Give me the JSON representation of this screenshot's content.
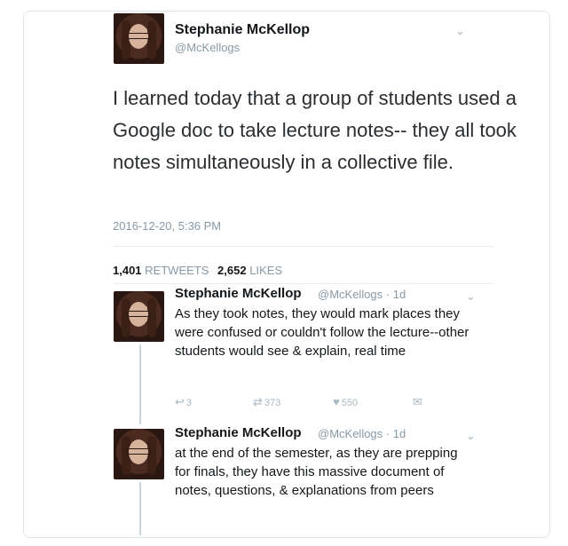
{
  "tweet": {
    "author_name": "Stephanie McKellop",
    "author_handle": "@McKellogs",
    "text": "I learned today that a group of students used a Google doc to take lecture notes-- they all took notes simultaneously in a collective file.",
    "timestamp": "2016-12-20, 5:36 PM",
    "retweets_count": "1,401",
    "retweets_label": "RETWEETS",
    "likes_count": "2,652",
    "likes_label": "LIKES"
  },
  "replies": [
    {
      "author_name": "Stephanie McKellop",
      "meta": "@McKellogs · 1d",
      "text": "As they took notes, they would mark places they were confused or couldn't follow the lecture--other students would see & explain, real time",
      "reply_count": "3",
      "retweet_count": "373",
      "like_count": "550"
    },
    {
      "author_name": "Stephanie McKellop",
      "meta": "@McKellogs · 1d",
      "text": "at the end of the semester, as they are prepping for finals, they have this massive document of notes, questions, & explanations from peers"
    }
  ],
  "icons": {
    "reply": "reply-icon",
    "retweet": "retweet-icon",
    "like": "heart-icon",
    "dm": "envelope-icon",
    "more": "chevron-down-icon"
  }
}
